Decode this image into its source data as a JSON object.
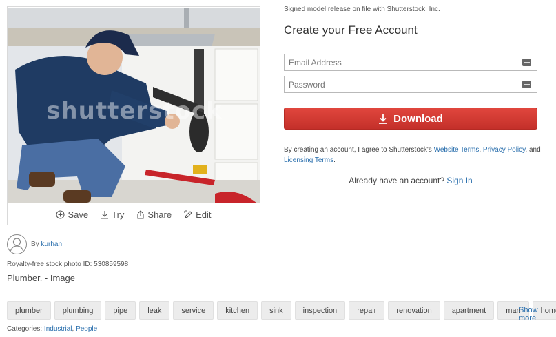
{
  "image": {
    "watermark": "shutterstock",
    "actions": [
      {
        "label": "Save",
        "icon": "plus-circle-icon"
      },
      {
        "label": "Try",
        "icon": "download-icon"
      },
      {
        "label": "Share",
        "icon": "share-icon"
      },
      {
        "label": "Edit",
        "icon": "edit-icon"
      }
    ]
  },
  "contributor": {
    "by_label": "By",
    "name": "kurhan"
  },
  "photo_id": "Royalty-free stock photo ID: 530859598",
  "photo_title": "Plumber. - Image",
  "tags": [
    "plumber",
    "plumbing",
    "pipe",
    "leak",
    "service",
    "kitchen",
    "sink",
    "inspection",
    "repair",
    "renovation",
    "apartment",
    "man",
    "home"
  ],
  "show_more": "Show more",
  "categories": {
    "label": "Categories:",
    "items": [
      "Industrial",
      "People"
    ]
  },
  "release_text": "Signed model release on file with Shutterstock, Inc.",
  "form": {
    "title": "Create your Free Account",
    "email_placeholder": "Email Address",
    "password_placeholder": "Password",
    "download_label": "Download",
    "terms_prefix": "By creating an account, I agree to Shutterstock's",
    "website_terms": "Website Terms",
    "privacy_policy": "Privacy Policy",
    "and_text": ", and",
    "licensing_terms": "Licensing Terms",
    "terms_suffix": ".",
    "already_text": "Already have an account?",
    "sign_in": "Sign In"
  },
  "colors": {
    "accent_red": "#d23a33",
    "link_blue": "#2a6fad"
  }
}
